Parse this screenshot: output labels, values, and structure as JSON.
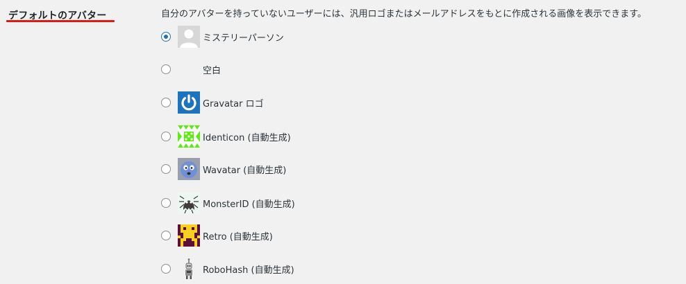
{
  "setting": {
    "label": "デフォルトのアバター",
    "description": "自分のアバターを持っていないユーザーには、汎用ロゴまたはメールアドレスをもとに作成される画像を表示できます。"
  },
  "options": [
    {
      "label": "ミステリーパーソン",
      "checked": true,
      "icon": "mystery-person-avatar-icon"
    },
    {
      "label": "空白",
      "checked": false,
      "icon": "blank-avatar-icon"
    },
    {
      "label": "Gravatar ロゴ",
      "checked": false,
      "icon": "gravatar-logo-icon"
    },
    {
      "label": "Identicon (自動生成)",
      "checked": false,
      "icon": "identicon-avatar-icon"
    },
    {
      "label": "Wavatar (自動生成)",
      "checked": false,
      "icon": "wavatar-avatar-icon"
    },
    {
      "label": "MonsterID (自動生成)",
      "checked": false,
      "icon": "monsterid-avatar-icon"
    },
    {
      "label": "Retro (自動生成)",
      "checked": false,
      "icon": "retro-avatar-icon"
    },
    {
      "label": "RoboHash (自動生成)",
      "checked": false,
      "icon": "robohash-avatar-icon"
    }
  ],
  "colors": {
    "accent": "#2271b1",
    "underline": "#e1190f",
    "gravatar_blue": "#1e73be"
  }
}
